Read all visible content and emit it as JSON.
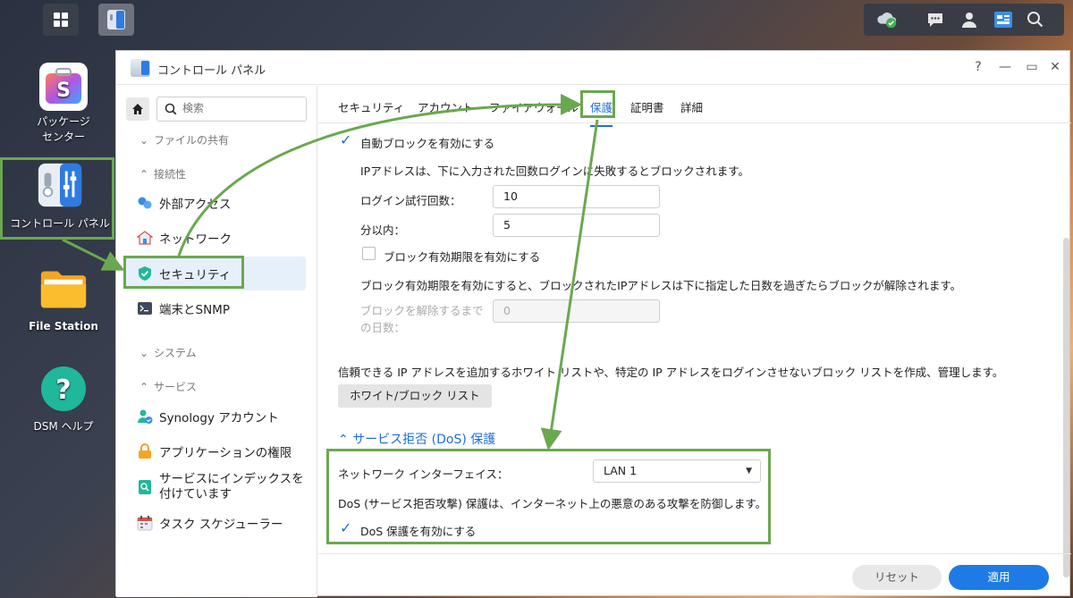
{
  "window": {
    "title": "コントロール パネル",
    "controls": {
      "help": "?",
      "minimize": "—",
      "maximize": "▭",
      "close": "✕"
    }
  },
  "desktop": {
    "icons": [
      {
        "label_line1": "パッケージ",
        "label_line2": "センター"
      },
      {
        "label": "コントロール パネル"
      },
      {
        "label": "File Station"
      },
      {
        "label": "DSM ヘルプ"
      }
    ]
  },
  "sidebar": {
    "search_placeholder": "検索",
    "groups": {
      "file_share": "ファイルの共有",
      "connectivity": "接続性",
      "system": "システム",
      "services": "サービス"
    },
    "items": {
      "external_access": "外部アクセス",
      "network": "ネットワーク",
      "security": "セキュリティ",
      "terminal_snmp": "端末とSNMP",
      "synology_account": "Synology アカウント",
      "app_privileges": "アプリケーションの権限",
      "indexing_line1": "サービスにインデックスを",
      "indexing_line2": "付けています",
      "task_scheduler": "タスク スケジューラー"
    }
  },
  "tabs": [
    "セキュリティ",
    "アカウント",
    "ファイアウォール",
    "保護",
    "証明書",
    "詳細"
  ],
  "protection": {
    "auto_block_label": "自動ブロックを有効にする",
    "auto_block_desc": "IPアドレスは、下に入力された回数ログインに失敗するとブロックされます。",
    "login_attempts_label": "ログイン試行回数：",
    "login_attempts_value": "10",
    "within_minutes_label": "分以内：",
    "within_minutes_value": "5",
    "block_expire_label": "ブロック有効期限を有効にする",
    "block_expire_desc": "ブロック有効期限を有効にすると、ブロックされたIPアドレスは下に指定した日数を過ぎたらブロックが解除されます。",
    "unblock_days_label_line1": "ブロックを解除するまで",
    "unblock_days_label_line2": "の日数：",
    "unblock_days_value": "0",
    "allow_block_desc": "信頼できる IP アドレスを追加するホワイト リストや、特定の IP アドレスをログインさせないブロック リストを作成、管理します。",
    "allow_block_button": "ホワイト/ブロック リスト",
    "dos_section": "サービス拒否 (DoS) 保護",
    "network_interface_label": "ネットワーク インターフェイス：",
    "network_interface_value": "LAN 1",
    "dos_desc": "DoS (サービス拒否攻撃) 保護は、インターネット上の悪意のある攻撃を防御します。",
    "dos_enable_label": "DoS 保護を有効にする"
  },
  "footer": {
    "reset": "リセット",
    "apply": "適用"
  },
  "colors": {
    "accent": "#1e6fd9",
    "annotation": "#6aa84f",
    "apply_button": "#1e7be6"
  }
}
